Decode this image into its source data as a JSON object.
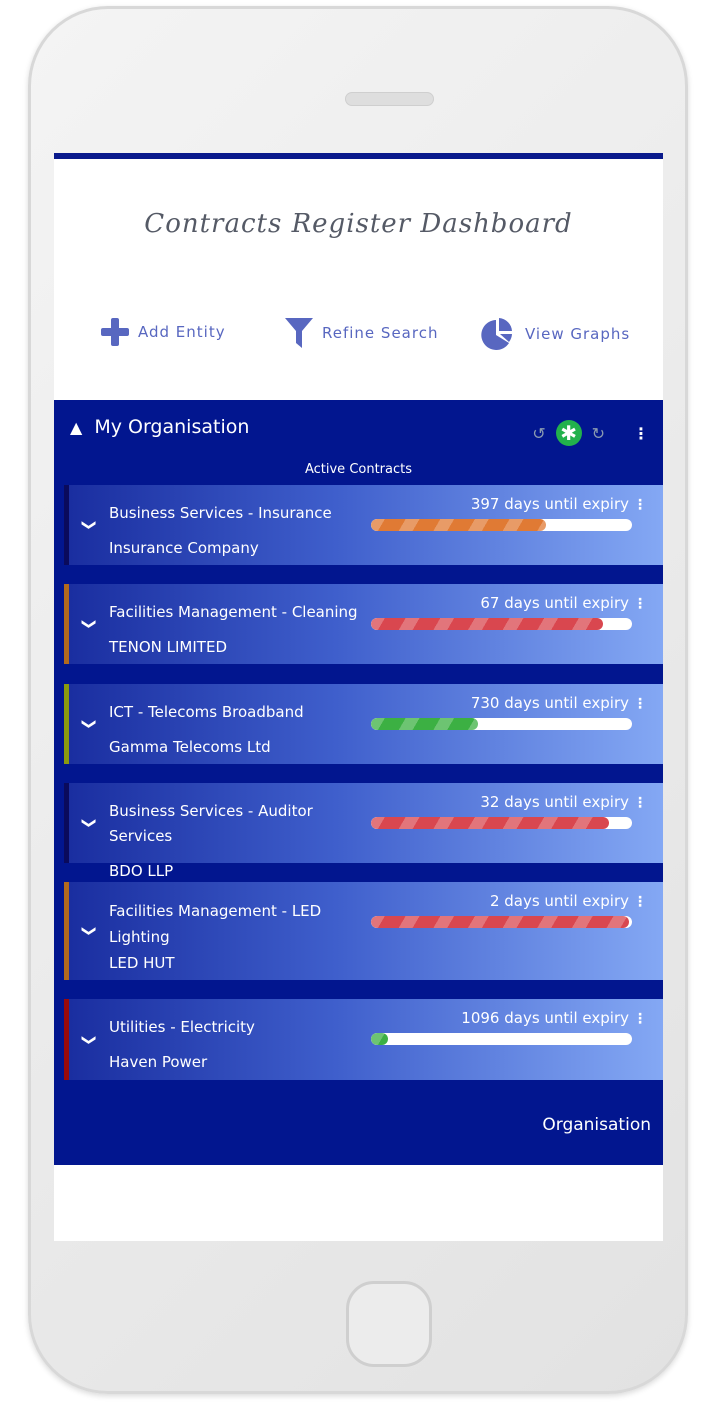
{
  "header": {
    "title": "Contracts Register Dashboard"
  },
  "actions": [
    {
      "label": "Add Entity",
      "icon": "plus-icon"
    },
    {
      "label": "Refine Search",
      "icon": "filter-icon"
    },
    {
      "label": "View Graphs",
      "icon": "pie-chart-icon"
    }
  ],
  "colors": {
    "accent": "#5867c0",
    "panel": "#02168f",
    "active_toggle": "#22b14c"
  },
  "panel": {
    "title": "My Organisation",
    "section": "Active Contracts",
    "footer": "Organisation",
    "contracts": [
      {
        "category": "Business Services - Insurance",
        "supplier": "Insurance Company",
        "days": "397 days until expiry",
        "progress": 0.67,
        "bar_color": "#e07a34",
        "border_color": "#0a0a5c"
      },
      {
        "category": "Facilities Management - Cleaning",
        "supplier": "TENON LIMITED",
        "days": "67 days until expiry",
        "progress": 0.89,
        "bar_color": "#d9474f",
        "border_color": "#b26a1e"
      },
      {
        "category": "ICT - Telecoms Broadband",
        "supplier": "Gamma Telecoms Ltd",
        "days": "730 days until expiry",
        "progress": 0.41,
        "bar_color": "#3cb043",
        "border_color": "#8a9a10"
      },
      {
        "category": "Business Services - Auditor Services",
        "supplier": "BDO LLP",
        "days": "32 days until expiry",
        "progress": 0.91,
        "bar_color": "#d9474f",
        "border_color": "#0a0a5c"
      },
      {
        "category": "Facilities Management - LED Lighting",
        "supplier": "LED HUT",
        "days": "2 days until expiry",
        "progress": 0.99,
        "bar_color": "#d9474f",
        "border_color": "#b26a1e"
      },
      {
        "category": "Utilities - Electricity",
        "supplier": "Haven Power",
        "days": "1096 days until expiry",
        "progress": 0.065,
        "bar_color": "#3cb043",
        "border_color": "#9a0a0a"
      }
    ]
  }
}
